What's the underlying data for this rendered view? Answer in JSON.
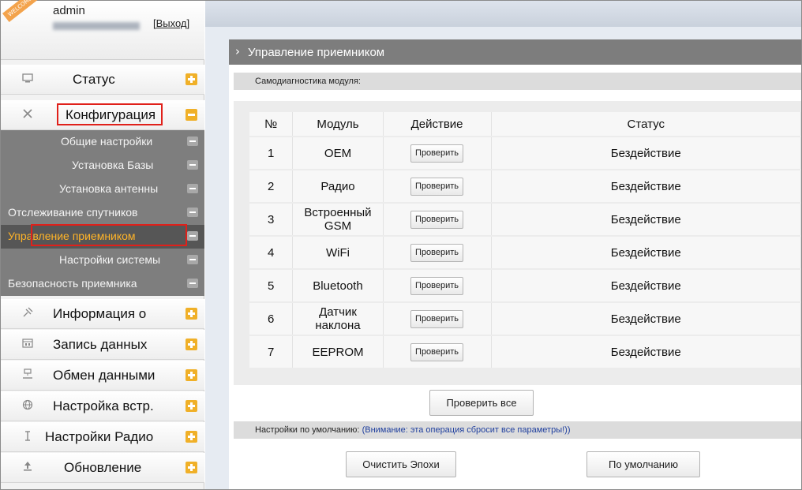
{
  "user": {
    "ribbon": "WELCOME",
    "name": "admin",
    "logout_label": "[Выход]"
  },
  "sidebar": {
    "items": [
      {
        "label": "Статус",
        "icon": "monitor-icon"
      },
      {
        "label": "Конфигурация",
        "icon": "tools-icon"
      },
      {
        "label": "Информация о",
        "icon": "satellite-icon"
      },
      {
        "label": "Запись данных",
        "icon": "calendar-icon"
      },
      {
        "label": "Обмен данными",
        "icon": "network-icon"
      },
      {
        "label": "Настройка встр.",
        "icon": "globe-icon"
      },
      {
        "label": "Настройки Радио",
        "icon": "antenna-icon"
      },
      {
        "label": "Обновление",
        "icon": "upload-icon"
      }
    ],
    "submenu": [
      {
        "label": "Общие настройки"
      },
      {
        "label": "Установка Базы"
      },
      {
        "label": "Установка антенны"
      },
      {
        "label": "Отслеживание спутников"
      },
      {
        "label": "Управление приемником"
      },
      {
        "label": "Настройки системы"
      },
      {
        "label": "Безопасность приемника"
      }
    ]
  },
  "main": {
    "title": "Управление приемником",
    "section_selfcheck": "Самодиагностика модуля:",
    "table": {
      "headers": [
        "№",
        "Модуль",
        "Действие",
        "Статус"
      ],
      "check_label": "Проверить",
      "rows": [
        {
          "num": "1",
          "module": "OEM",
          "status": "Бездействие"
        },
        {
          "num": "2",
          "module": "Радио",
          "status": "Бездействие"
        },
        {
          "num": "3",
          "module": "Встроенный GSM",
          "status": "Бездействие"
        },
        {
          "num": "4",
          "module": "WiFi",
          "status": "Бездействие"
        },
        {
          "num": "5",
          "module": "Bluetooth",
          "status": "Бездействие"
        },
        {
          "num": "6",
          "module": "Датчик наклона",
          "status": "Бездействие"
        },
        {
          "num": "7",
          "module": "EEPROM",
          "status": "Бездействие"
        }
      ]
    },
    "check_all_label": "Проверить все",
    "defaults_label": "Настройки по умолчанию:",
    "defaults_warning": "(Внимание: эта операция сбросит все параметры!))",
    "clear_epochs_label": "Очистить Эпохи",
    "factory_default_label": "По умолчанию"
  },
  "colors": {
    "accent_orange": "#f0b028",
    "active_submenu_text": "#ffb428",
    "highlight_red": "#e0201a",
    "warning_blue": "#1f3f9e"
  }
}
